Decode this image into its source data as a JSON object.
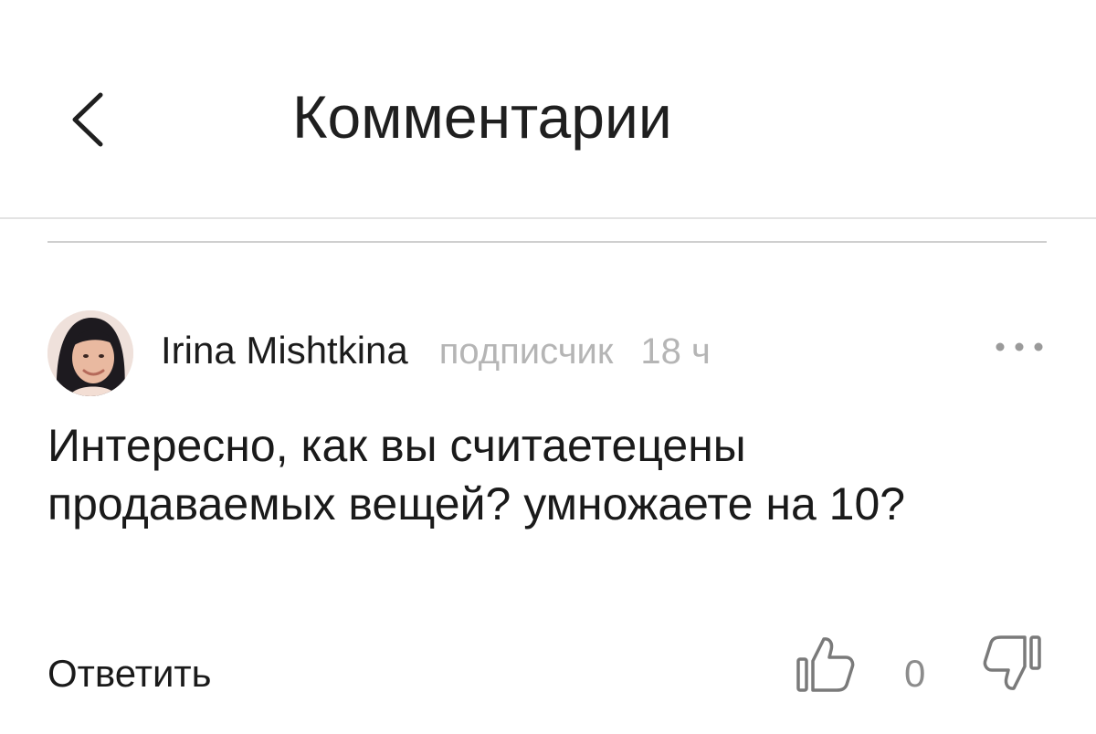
{
  "header": {
    "title": "Комментарии",
    "back_icon": "chevron-left-icon"
  },
  "comment": {
    "author": "Irina Mishtkina",
    "role": "подписчик",
    "time": "18 ч",
    "more_icon": "more-horizontal-icon",
    "text": "Интересно, как вы считаетецены продаваемых вещей? умножаете на 10?",
    "reply_label": "Ответить",
    "like_icon": "thumbs-up-icon",
    "likes": "0",
    "dislike_icon": "thumbs-down-icon"
  }
}
